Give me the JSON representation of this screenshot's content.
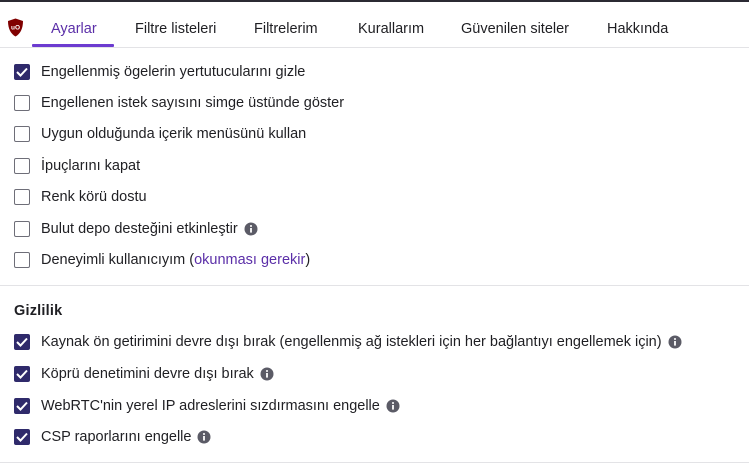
{
  "tabs": [
    {
      "label": "Ayarlar",
      "active": true
    },
    {
      "label": "Filtre listeleri",
      "active": false
    },
    {
      "label": "Filtrelerim",
      "active": false
    },
    {
      "label": "Kurallarım",
      "active": false
    },
    {
      "label": "Güvenilen siteler",
      "active": false
    },
    {
      "label": "Hakkında",
      "active": false
    }
  ],
  "appearance": {
    "options": [
      {
        "label": "Engellenmiş ögelerin yertutucularını gizle",
        "checked": true
      },
      {
        "label": "Engellenen istek sayısını simge üstünde göster",
        "checked": false
      },
      {
        "label": "Uygun olduğunda içerik menüsünü kullan",
        "checked": false
      },
      {
        "label": "İpuçlarını kapat",
        "checked": false
      },
      {
        "label": "Renk körü dostu",
        "checked": false
      },
      {
        "label": "Bulut depo desteğini etkinleştir",
        "checked": false
      },
      {
        "label_prefix": "Deneyimli kullanıcıyım (",
        "label_link": "okunması gerekir",
        "label_suffix": ")",
        "checked": false
      }
    ]
  },
  "privacy": {
    "title": "Gizlilik",
    "options": [
      {
        "label": "Kaynak ön getirimini devre dışı bırak (engellenmiş ağ istekleri için her bağlantıyı engellemek için)",
        "checked": true
      },
      {
        "label": "Köprü denetimini devre dışı bırak",
        "checked": true
      },
      {
        "label": "WebRTC'nin yerel IP adreslerini sızdırmasını engelle",
        "checked": true
      },
      {
        "label": "CSP raporlarını engelle",
        "checked": true
      }
    ]
  },
  "colors": {
    "accent": "#6c3bd0",
    "checkbox_checked": "#2f2a6b",
    "logo_red": "#800000"
  }
}
